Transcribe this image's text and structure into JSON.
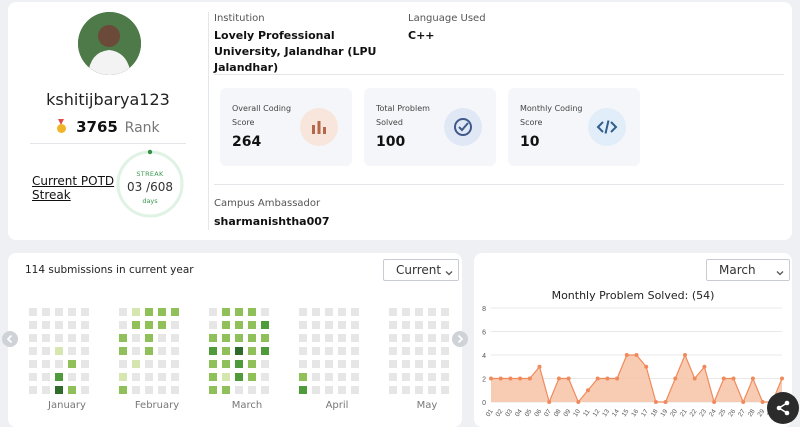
{
  "profile": {
    "username": "kshitijbarya123",
    "rank_value": "3765",
    "rank_label": "Rank",
    "potd_label": "Current POTD Streak",
    "streak_title": "STREAK",
    "streak_current": "03",
    "streak_total": "/608",
    "streak_unit": "days"
  },
  "institution": {
    "label": "Institution",
    "value": "Lovely Professional University, Jalandhar (LPU Jalandhar)"
  },
  "language": {
    "label": "Language Used",
    "value": "C++"
  },
  "stats": [
    {
      "label": "Overall Coding Score",
      "value": "264",
      "icon": "bar-chart-icon"
    },
    {
      "label": "Total Problem Solved",
      "value": "100",
      "icon": "check-circle-icon"
    },
    {
      "label": "Monthly Coding Score",
      "value": "10",
      "icon": "code-icon"
    }
  ],
  "ambassador": {
    "label": "Campus Ambassador",
    "value": "sharmanishtha007"
  },
  "heatmap": {
    "title": "114 submissions in current year",
    "select_value": "Current",
    "months": [
      "January",
      "February",
      "March",
      "April",
      "May"
    ],
    "levels": [
      [
        [
          0,
          0,
          0,
          0,
          0
        ],
        [
          0,
          0,
          0,
          0,
          0
        ],
        [
          0,
          0,
          0,
          0,
          0
        ],
        [
          0,
          0,
          1,
          0,
          0
        ],
        [
          0,
          0,
          0,
          2,
          0
        ],
        [
          0,
          0,
          3,
          0,
          0
        ],
        [
          0,
          0,
          4,
          2,
          0
        ]
      ],
      [
        [
          0,
          1,
          2,
          2,
          2
        ],
        [
          0,
          2,
          2,
          2,
          0
        ],
        [
          2,
          0,
          2,
          0,
          0
        ],
        [
          2,
          0,
          2,
          0,
          0
        ],
        [
          0,
          1,
          0,
          0,
          0
        ],
        [
          1,
          0,
          0,
          0,
          0
        ],
        [
          2,
          0,
          0,
          0,
          0
        ]
      ],
      [
        [
          0,
          2,
          2,
          2,
          0
        ],
        [
          0,
          2,
          2,
          2,
          3
        ],
        [
          2,
          2,
          2,
          2,
          2
        ],
        [
          3,
          2,
          4,
          2,
          3
        ],
        [
          2,
          2,
          3,
          2,
          0
        ],
        [
          2,
          1,
          3,
          2,
          0
        ],
        [
          2,
          2,
          0,
          0,
          0
        ]
      ],
      [
        [
          0,
          0,
          0,
          0,
          0
        ],
        [
          0,
          0,
          0,
          0,
          0
        ],
        [
          0,
          0,
          0,
          0,
          0
        ],
        [
          0,
          0,
          0,
          0,
          0
        ],
        [
          0,
          0,
          0,
          0,
          0
        ],
        [
          2,
          0,
          0,
          0,
          0
        ],
        [
          3,
          0,
          0,
          0,
          0
        ]
      ],
      [
        [
          0,
          0,
          0,
          0,
          0
        ],
        [
          0,
          0,
          0,
          0,
          0
        ],
        [
          0,
          0,
          0,
          0,
          0
        ],
        [
          0,
          0,
          0,
          0,
          0
        ],
        [
          0,
          0,
          0,
          0,
          0
        ],
        [
          0,
          0,
          0,
          0,
          0
        ],
        [
          0,
          0,
          0,
          0,
          0
        ]
      ]
    ],
    "colors": {
      "0": "#e6e6e6",
      "1": "#d6e6b0",
      "2": "#8fc05a",
      "3": "#4f9a3a",
      "4": "#2f6b2a"
    }
  },
  "monthly": {
    "select_value": "March"
  },
  "chart_data": {
    "type": "area",
    "title": "Monthly Problem Solved: (54)",
    "x": [
      "01",
      "02",
      "03",
      "04",
      "05",
      "06",
      "07",
      "08",
      "09",
      "10",
      "11",
      "12",
      "13",
      "14",
      "15",
      "16",
      "17",
      "18",
      "19",
      "20",
      "21",
      "22",
      "23",
      "24",
      "25",
      "26",
      "27",
      "28",
      "29",
      "30",
      "31"
    ],
    "values": [
      2,
      2,
      2,
      2,
      2,
      3,
      0,
      2,
      2,
      0,
      1,
      2,
      2,
      2,
      4,
      4,
      3,
      0,
      0,
      2,
      4,
      2,
      3,
      0,
      2,
      2,
      0,
      2,
      0,
      0,
      2
    ],
    "ylim": [
      0,
      8
    ],
    "yticks": [
      "0",
      "2",
      "4",
      "6",
      "8"
    ],
    "line_color": "#f08a5d",
    "fill_color": "#f7c3a6",
    "grid": true
  }
}
